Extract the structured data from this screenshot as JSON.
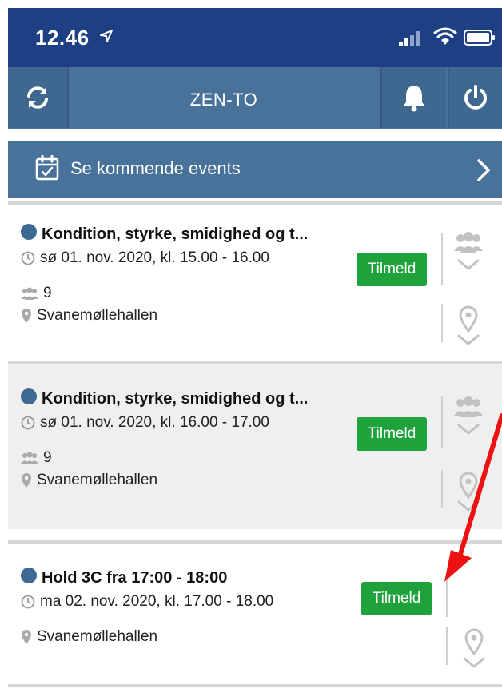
{
  "status_bar": {
    "time": "12.46"
  },
  "nav": {
    "title": "ZEN-TO"
  },
  "events_link": {
    "label": "Se kommende events"
  },
  "cards": [
    {
      "title": "Kondition, styrke, smidighed og t...",
      "datetime": "sø 01. nov. 2020, kl. 15.00 - 16.00",
      "participants": "9",
      "location": "Svanemøllehallen",
      "action": "Tilmeld"
    },
    {
      "title": "Kondition, styrke, smidighed og t...",
      "datetime": "sø 01. nov. 2020, kl. 16.00 - 17.00",
      "participants": "9",
      "location": "Svanemøllehallen",
      "action": "Tilmeld"
    },
    {
      "title": "Hold 3C fra 17:00 - 18:00",
      "datetime": "ma 02. nov. 2020, kl. 17.00 - 18.00",
      "location": "Svanemøllehallen",
      "action": "Tilmeld"
    }
  ],
  "colors": {
    "header": "#1d3f83",
    "bar": "#48729a",
    "button": "#1fa23b",
    "annotation": "#ee1111"
  }
}
